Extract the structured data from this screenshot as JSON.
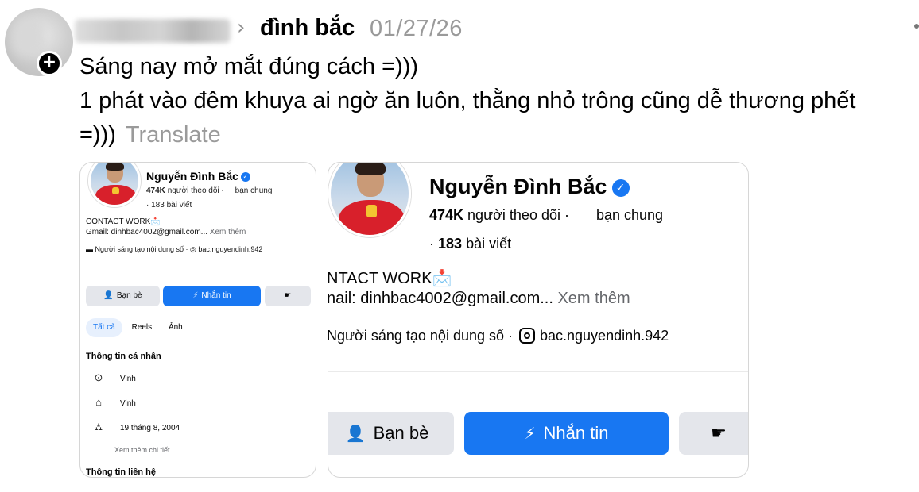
{
  "post": {
    "username_blurred": "",
    "follow_badge": "+",
    "chevron": "›",
    "reply_to": "đình bắc",
    "date": "01/27/26",
    "text_line1": "Sáng nay mở mắt đúng cách =)))",
    "text_line2": "1 phát vào đêm khuya ai ngờ ăn luôn, thằng nhỏ trông cũng dễ thương phết",
    "text_line3": "=)))",
    "translate_label": "Translate"
  },
  "images": {
    "left": {
      "name": "Nguyễn Đình Bắc",
      "verified_icon": "✓",
      "followers_count": "474K",
      "followers_label": "người theo dõi ·",
      "mutual_label": "bạn chung",
      "posts": "· 183 bài viết",
      "contact": "CONTACT WORK📩",
      "gmail": "Gmail: dinhbac4002@gmail.com...",
      "see_more": "Xem thêm",
      "creator": "Người sáng tạo nội dung số · ◎ bac.nguyendinh.942",
      "btn_friends": "Bạn bè",
      "btn_message": "Nhắn tin",
      "btn_more_icon": "☛",
      "tabs": [
        "Tất cả",
        "Reels",
        "Ảnh"
      ],
      "personal_info_title": "Thông tin cá nhân",
      "info_1": "Vinh",
      "info_2": "Vinh",
      "info_3": "19 tháng 8, 2004",
      "see_more_details": "Xem thêm chi tiết",
      "contact_info_title": "Thông tin liên hệ"
    },
    "right": {
      "name": "Nguyễn Đình Bắc",
      "verified_icon": "✓",
      "followers_count": "474K",
      "followers_label": "người theo dõi ·",
      "mutual_label": "bạn chung",
      "posts_count": "183",
      "posts_label": "bài viết",
      "contact": "NTACT WORK📩",
      "gmail": "nail: dinhbac4002@gmail.com...",
      "see_more": "Xem thêm",
      "creator": "Người sáng tạo nội dung số ·",
      "instagram": "bac.nguyendinh.942",
      "btn_friends": "Bạn bè",
      "btn_message": "Nhắn tin",
      "btn_more_icon": "☛"
    }
  },
  "colors": {
    "facebook_blue": "#1877f2",
    "secondary_text": "#9a9a9a",
    "button_gray": "#e4e6eb"
  }
}
